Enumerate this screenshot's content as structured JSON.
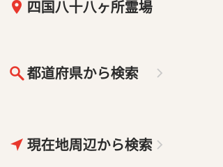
{
  "header": {
    "title": "四国八十八ヶ所霊場",
    "icon": "map-pin-icon"
  },
  "menu": {
    "items": [
      {
        "label": "都道府県から検索",
        "icon": "search-icon"
      },
      {
        "label": "現在地周辺から検索",
        "icon": "location-arrow-icon"
      }
    ]
  },
  "colors": {
    "accent": "#e8372c",
    "text": "#2a2a2a",
    "background": "#f7f3ee",
    "chevron": "#c8c8c8"
  }
}
